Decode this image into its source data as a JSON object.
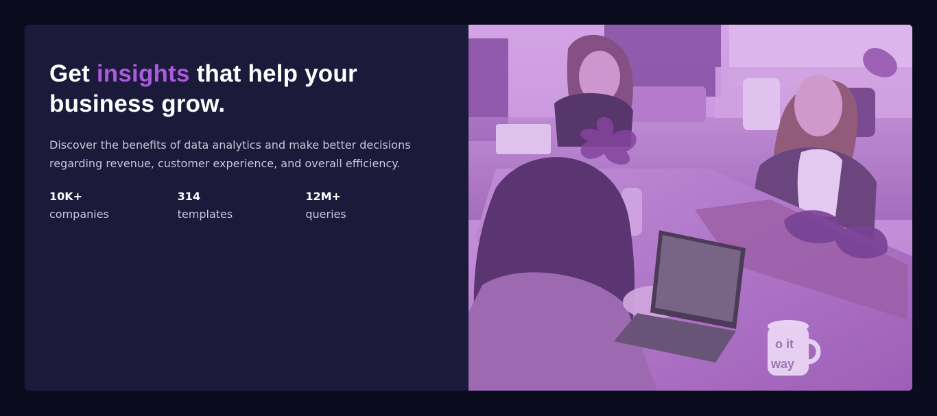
{
  "hero": {
    "headline_prefix": "Get ",
    "headline_highlight": "insights",
    "headline_suffix": " that help your business grow.",
    "description": "Discover the benefits of data analytics and make better decisions regarding revenue, customer experience, and overall efficiency."
  },
  "stats": [
    {
      "value": "10K+",
      "label": "companies"
    },
    {
      "value": "314",
      "label": "templates"
    },
    {
      "value": "12M+",
      "label": "queries"
    }
  ],
  "photo": {
    "mug_text_1": "o it",
    "mug_text_2": "way"
  },
  "colors": {
    "page_background": "#0a0c1d",
    "card_background": "#1c1a3a",
    "accent": "#a95bdc",
    "text_primary": "#ffffff",
    "text_secondary": "#c9c7db",
    "image_overlay": "#aa5cdb"
  }
}
